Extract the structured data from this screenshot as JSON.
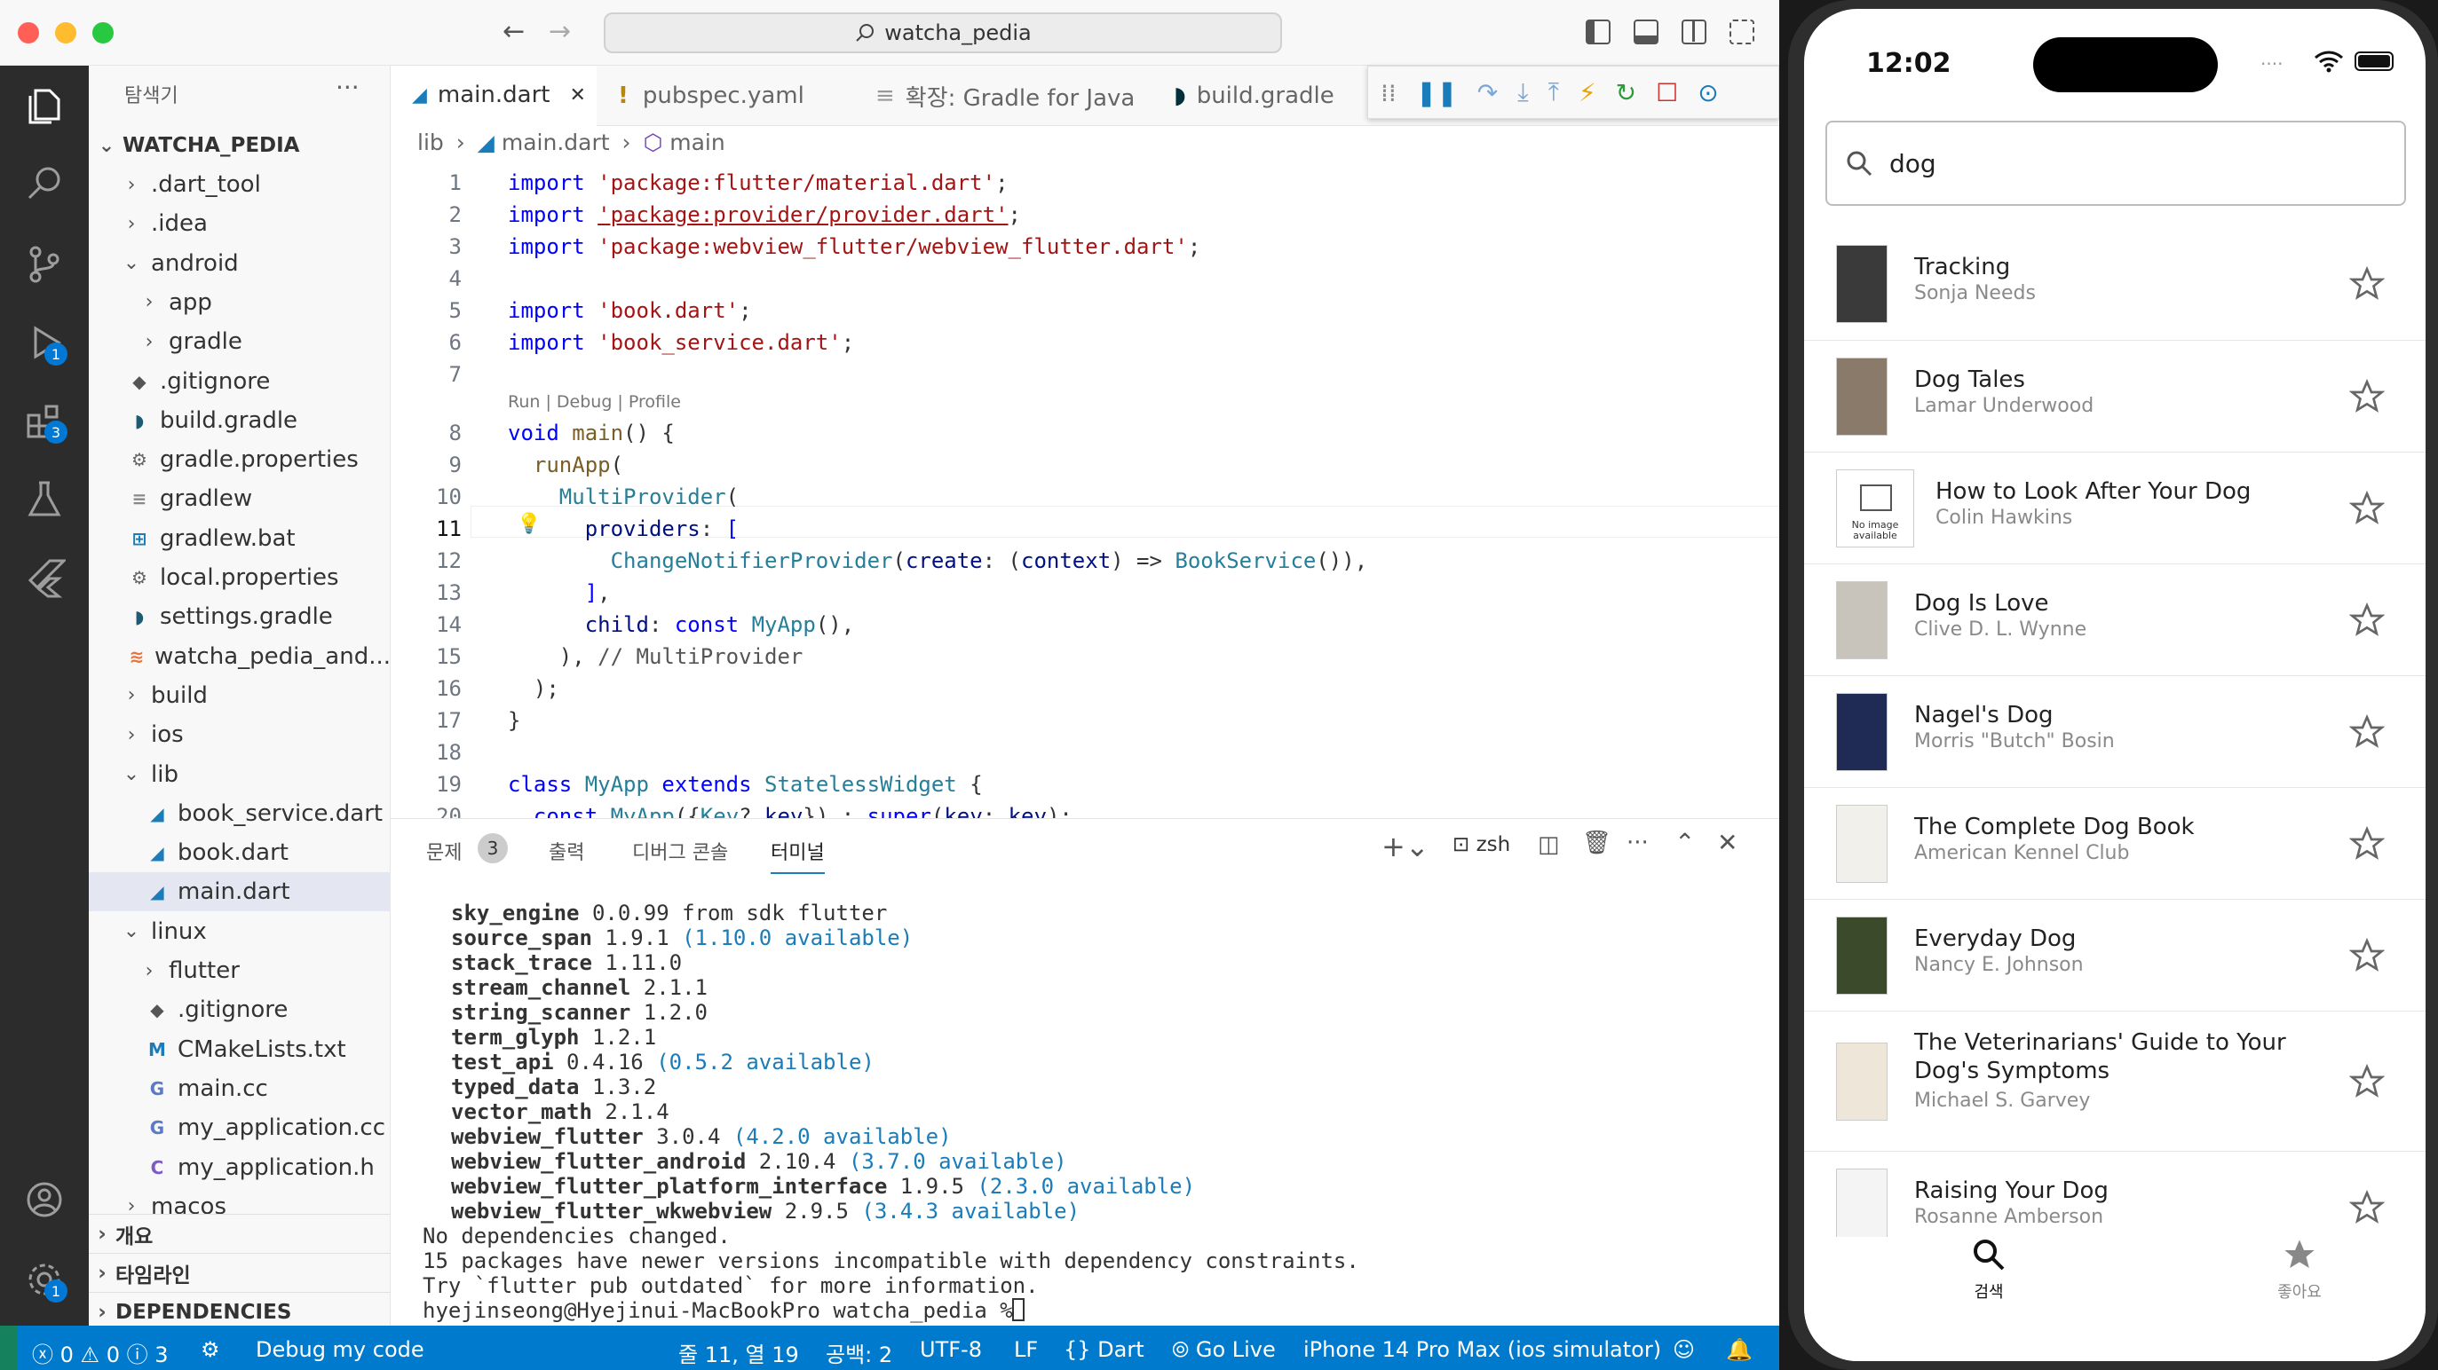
{
  "window": {
    "command_center": "watcha_pedia"
  },
  "activity_badges": {
    "debug": "1",
    "extensions": "3",
    "settings": "1"
  },
  "sidebar": {
    "title": "탐색기",
    "more": "···",
    "root": "WATCHA_PEDIA",
    "items": [
      {
        "label": ".dart_tool",
        "icon": "chevron-right"
      },
      {
        "label": ".idea",
        "icon": "chevron-right"
      },
      {
        "label": "android",
        "icon": "chevron-down"
      },
      {
        "label": "app",
        "icon": "chevron-right"
      },
      {
        "label": "gradle",
        "icon": "chevron-right"
      },
      {
        "label": ".gitignore",
        "icon": "git-icon"
      },
      {
        "label": "build.gradle",
        "icon": "gradle-icon"
      },
      {
        "label": "gradle.properties",
        "icon": "gear-icon"
      },
      {
        "label": "gradlew",
        "icon": "text-icon"
      },
      {
        "label": "gradlew.bat",
        "icon": "windows-icon"
      },
      {
        "label": "local.properties",
        "icon": "gear-icon"
      },
      {
        "label": "settings.gradle",
        "icon": "gradle-icon"
      },
      {
        "label": "watcha_pedia_and...",
        "icon": "rss-icon"
      },
      {
        "label": "build",
        "icon": "chevron-right"
      },
      {
        "label": "ios",
        "icon": "chevron-right"
      },
      {
        "label": "lib",
        "icon": "chevron-down"
      },
      {
        "label": "book_service.dart",
        "icon": "dart-icon"
      },
      {
        "label": "book.dart",
        "icon": "dart-icon"
      },
      {
        "label": "main.dart",
        "icon": "dart-icon"
      },
      {
        "label": "linux",
        "icon": "chevron-down"
      },
      {
        "label": "flutter",
        "icon": "chevron-right"
      },
      {
        "label": ".gitignore",
        "icon": "git-icon"
      },
      {
        "label": "CMakeLists.txt",
        "icon": "cmake-icon"
      },
      {
        "label": "main.cc",
        "icon": "cpp-icon"
      },
      {
        "label": "my_application.cc",
        "icon": "cpp-icon"
      },
      {
        "label": "my_application.h",
        "icon": "c-icon"
      },
      {
        "label": "macos",
        "icon": "chevron-right"
      }
    ],
    "sections": [
      "개요",
      "타임라인",
      "DEPENDENCIES"
    ]
  },
  "tabs": [
    {
      "label": "main.dart",
      "close": "✕"
    },
    {
      "label": "pubspec.yaml"
    },
    {
      "label": "확장: Gradle for Java"
    },
    {
      "label": "build.gradle"
    }
  ],
  "breadcrumb": {
    "a": "lib",
    "b": "main.dart",
    "c": "main"
  },
  "editor": {
    "codelens": "Run | Debug | Profile",
    "line_numbers": [
      "1",
      "2",
      "3",
      "4",
      "5",
      "6",
      "7",
      "8",
      "9",
      "10",
      "11",
      "12",
      "13",
      "14",
      "15",
      "16",
      "17",
      "18",
      "19",
      "20"
    ]
  },
  "panel": {
    "tabs": [
      "문제",
      "출력",
      "디버그 콘솔",
      "터미널"
    ],
    "problems_count": "3",
    "shell": "zsh",
    "terminal_lines": [
      {
        "name": "sky_engine",
        "ver": "0.0.99 from sdk flutter",
        "avail": ""
      },
      {
        "name": "source_span",
        "ver": "1.9.1",
        "avail": "(1.10.0 available)"
      },
      {
        "name": "stack_trace",
        "ver": "1.11.0",
        "avail": ""
      },
      {
        "name": "stream_channel",
        "ver": "2.1.1",
        "avail": ""
      },
      {
        "name": "string_scanner",
        "ver": "1.2.0",
        "avail": ""
      },
      {
        "name": "term_glyph",
        "ver": "1.2.1",
        "avail": ""
      },
      {
        "name": "test_api",
        "ver": "0.4.16",
        "avail": "(0.5.2 available)"
      },
      {
        "name": "typed_data",
        "ver": "1.3.2",
        "avail": ""
      },
      {
        "name": "vector_math",
        "ver": "2.1.4",
        "avail": ""
      },
      {
        "name": "webview_flutter",
        "ver": "3.0.4",
        "avail": "(4.2.0 available)"
      },
      {
        "name": "webview_flutter_android",
        "ver": "2.10.4",
        "avail": "(3.7.0 available)"
      },
      {
        "name": "webview_flutter_platform_interface",
        "ver": "1.9.5",
        "avail": "(2.3.0 available)"
      },
      {
        "name": "webview_flutter_wkwebview",
        "ver": "2.9.5",
        "avail": "(3.4.3 available)"
      }
    ],
    "footer_lines": [
      "No dependencies changed.",
      "15 packages have newer versions incompatible with dependency constraints.",
      "Try `flutter pub outdated` for more information.",
      "hyejinseong@Hyejinui-MacBookPro watcha_pedia % "
    ]
  },
  "statusbar": {
    "errors": "0",
    "warnings": "0",
    "info": "3",
    "debug": "Debug my code",
    "position": "줄 11, 열 19",
    "spaces": "공백: 2",
    "encoding": "UTF-8",
    "eol": "LF",
    "language": "Dart",
    "golive": "Go Live",
    "device": "iPhone 14 Pro Max (ios simulator)"
  },
  "phone": {
    "time": "12:02",
    "search_value": "dog",
    "books": [
      {
        "title": "Tracking",
        "author": "Sonja Needs",
        "cover": "#3a3a3a"
      },
      {
        "title": "Dog Tales",
        "author": "Lamar Underwood",
        "cover": "#8a7a6a"
      },
      {
        "title": "How to Look After Your Dog",
        "author": "Colin Hawkins",
        "cover": "none",
        "noimg": "No image available"
      },
      {
        "title": "Dog Is Love",
        "author": "Clive D. L. Wynne",
        "cover": "#c9c4bb"
      },
      {
        "title": "Nagel's Dog",
        "author": "Morris \"Butch\" Bosin",
        "cover": "#1f2a55"
      },
      {
        "title": "The Complete Dog Book",
        "author": "American Kennel Club",
        "cover": "#f2f0ea"
      },
      {
        "title": "Everyday Dog",
        "author": "Nancy E. Johnson",
        "cover": "#3b4a2a"
      },
      {
        "title": "The Veterinarians' Guide to Your",
        "title2": "Dog's Symptoms",
        "author": "Michael S. Garvey",
        "cover": "#eee6d8"
      },
      {
        "title": "Raising Your Dog",
        "author": "Rosanne Amberson",
        "cover": "#f4f4f4"
      }
    ],
    "nav": {
      "search": "검색",
      "like": "좋아요"
    }
  }
}
